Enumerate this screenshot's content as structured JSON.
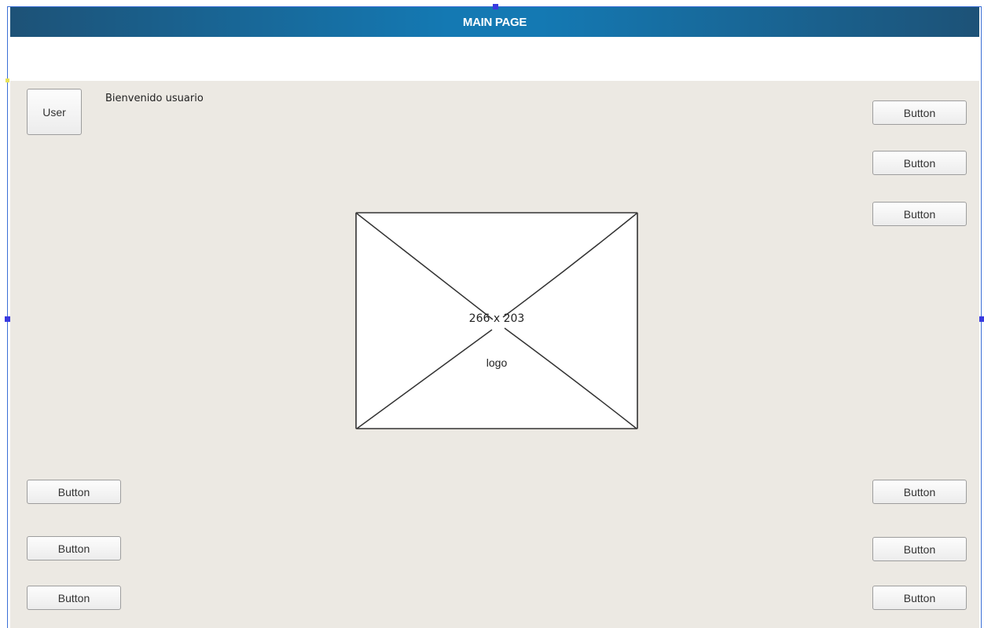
{
  "header": {
    "title": "MAIN PAGE"
  },
  "user_panel": {
    "user_button_label": "User",
    "welcome_text": "Bienvenido usuario"
  },
  "logo_placeholder": {
    "size_text": "266 x 203",
    "caption": "logo"
  },
  "right_top_buttons": [
    "Button",
    "Button",
    "Button"
  ],
  "left_bottom_buttons": [
    "Button",
    "Button",
    "Button"
  ],
  "right_bottom_buttons": [
    "Button",
    "Button",
    "Button"
  ],
  "colors": {
    "header_bg": "#1479b3",
    "header_text": "#ffffff",
    "canvas_bg": "#ece9e3",
    "selection": "#3b6fd6"
  }
}
